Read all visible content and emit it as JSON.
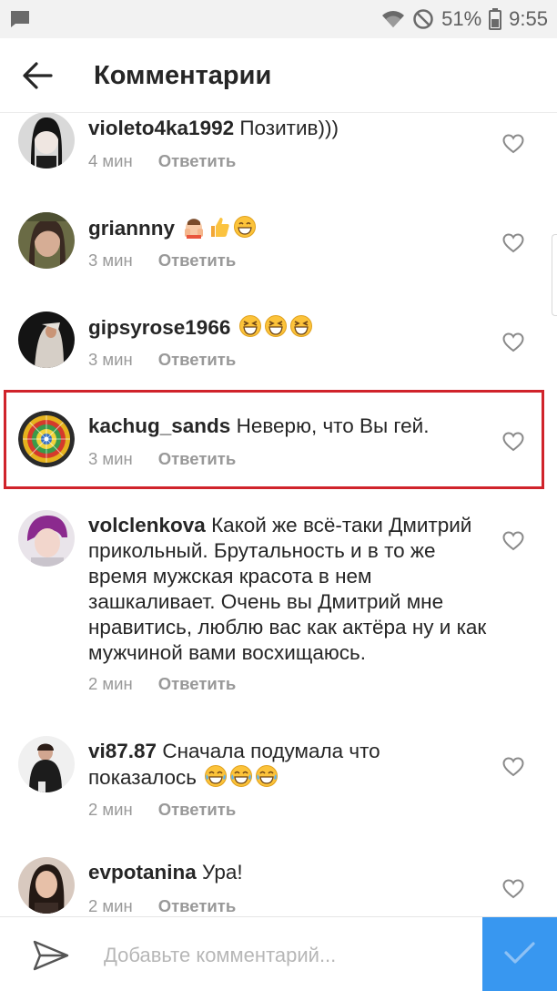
{
  "status_bar": {
    "battery": "51%",
    "time": "9:55",
    "icons": [
      "message-icon",
      "wifi-icon",
      "do-not-disturb-icon",
      "battery-icon"
    ]
  },
  "header": {
    "title": "Комментарии",
    "back_icon": "arrow-left-icon"
  },
  "comments": [
    {
      "username": "violeto4ka1992",
      "text": " Позитив)))",
      "time": "4 мин",
      "reply": "Ответить",
      "emojis": []
    },
    {
      "username": "griannny",
      "text": "",
      "time": "3 мин",
      "reply": "Ответить",
      "emojis": [
        "raising-hands",
        "thumbs-up",
        "grin"
      ]
    },
    {
      "username": "gipsyrose1966",
      "text": "",
      "time": "3 мин",
      "reply": "Ответить",
      "emojis": [
        "laughing",
        "laughing",
        "laughing"
      ]
    },
    {
      "username": "kachug_sands",
      "text": " Неверю, что Вы гей.",
      "time": "3 мин",
      "reply": "Ответить",
      "emojis": [],
      "highlighted": true
    },
    {
      "username": "volclenkova",
      "text": " Какой же всё-таки Дмитрий прикольный. Брутальность и в то же время мужская красота в нем зашкаливает. Очень вы Дмитрий мне нравитись, люблю вас как актёра ну и как мужчиной вами восхищаюсь.",
      "time": "2 мин",
      "reply": "Ответить",
      "emojis": []
    },
    {
      "username": "vi87.87",
      "text": " Сначала подумала что показалось",
      "time": "2 мин",
      "reply": "Ответить",
      "emojis": [
        "tears-of-joy",
        "tears-of-joy",
        "tears-of-joy"
      ]
    },
    {
      "username": "evpotanina",
      "text": " Ура!",
      "time": "2 мин",
      "reply": "Ответить",
      "emojis": []
    }
  ],
  "composer": {
    "placeholder": "Добавьте комментарий...",
    "send_icon": "paper-plane-icon",
    "post_icon": "checkmark-icon"
  },
  "colors": {
    "accent": "#3897f0",
    "highlight_border": "#d0232b",
    "meta_text": "#999999",
    "status_bar_bg": "#f2f2f2"
  }
}
